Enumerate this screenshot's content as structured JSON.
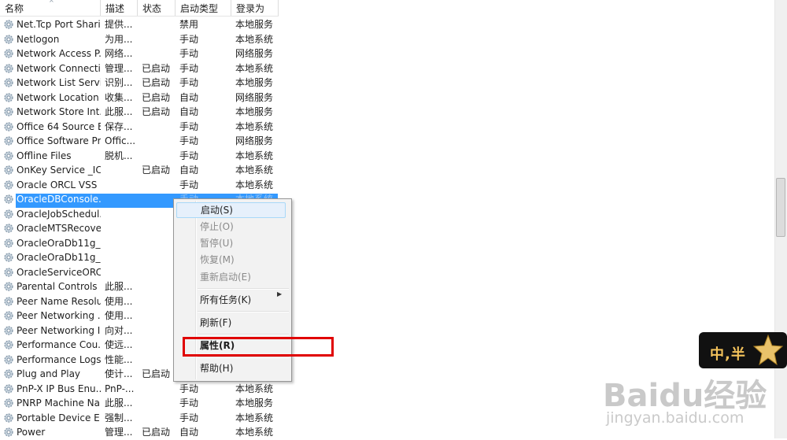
{
  "columns": {
    "name": "名称",
    "desc": "描述",
    "status": "状态",
    "startup": "启动类型",
    "logon": "登录为"
  },
  "rows": [
    {
      "name": "Net.Tcp Port Shari...",
      "desc": "提供...",
      "status": "",
      "startup": "禁用",
      "logon": "本地服务"
    },
    {
      "name": "Netlogon",
      "desc": "为用...",
      "status": "",
      "startup": "手动",
      "logon": "本地系统"
    },
    {
      "name": "Network Access P...",
      "desc": "网络...",
      "status": "",
      "startup": "手动",
      "logon": "网络服务"
    },
    {
      "name": "Network Connecti...",
      "desc": "管理...",
      "status": "已启动",
      "startup": "手动",
      "logon": "本地系统"
    },
    {
      "name": "Network List Service",
      "desc": "识别...",
      "status": "已启动",
      "startup": "手动",
      "logon": "本地服务"
    },
    {
      "name": "Network Location ...",
      "desc": "收集...",
      "status": "已启动",
      "startup": "自动",
      "logon": "网络服务"
    },
    {
      "name": "Network Store Int...",
      "desc": "此服...",
      "status": "已启动",
      "startup": "自动",
      "logon": "本地服务"
    },
    {
      "name": "Office 64 Source E...",
      "desc": "保存...",
      "status": "",
      "startup": "手动",
      "logon": "本地系统"
    },
    {
      "name": "Office Software Pr...",
      "desc": "Offic...",
      "status": "",
      "startup": "手动",
      "logon": "网络服务"
    },
    {
      "name": "Offline Files",
      "desc": "脱机...",
      "status": "",
      "startup": "手动",
      "logon": "本地系统"
    },
    {
      "name": "OnKey Service _IC...",
      "desc": "",
      "status": "已启动",
      "startup": "自动",
      "logon": "本地系统"
    },
    {
      "name": "Oracle ORCL VSS ...",
      "desc": "",
      "status": "",
      "startup": "手动",
      "logon": "本地系统"
    },
    {
      "name": "OracleDBConsole...",
      "desc": "",
      "status": "",
      "startup": "手动",
      "logon": "本地系统"
    },
    {
      "name": "OracleJobSchedul...",
      "desc": "",
      "status": "",
      "startup": "",
      "logon": ""
    },
    {
      "name": "OracleMTSRecove...",
      "desc": "",
      "status": "",
      "startup": "",
      "logon": ""
    },
    {
      "name": "OracleOraDb11g_...",
      "desc": "",
      "status": "",
      "startup": "",
      "logon": ""
    },
    {
      "name": "OracleOraDb11g_...",
      "desc": "",
      "status": "",
      "startup": "",
      "logon": ""
    },
    {
      "name": "OracleServiceORCL",
      "desc": "",
      "status": "",
      "startup": "",
      "logon": ""
    },
    {
      "name": "Parental Controls",
      "desc": "此服...",
      "status": "",
      "startup": "",
      "logon": ""
    },
    {
      "name": "Peer Name Resolu...",
      "desc": "使用...",
      "status": "",
      "startup": "",
      "logon": ""
    },
    {
      "name": "Peer Networking ...",
      "desc": "使用...",
      "status": "",
      "startup": "",
      "logon": ""
    },
    {
      "name": "Peer Networking I...",
      "desc": "向对...",
      "status": "",
      "startup": "",
      "logon": ""
    },
    {
      "name": "Performance Cou...",
      "desc": "使远...",
      "status": "",
      "startup": "",
      "logon": ""
    },
    {
      "name": "Performance Logs...",
      "desc": "性能...",
      "status": "",
      "startup": "",
      "logon": ""
    },
    {
      "name": "Plug and Play",
      "desc": "使计...",
      "status": "已启动",
      "startup": "",
      "logon": ""
    },
    {
      "name": "PnP-X IP Bus Enu...",
      "desc": "PnP-...",
      "status": "",
      "startup": "手动",
      "logon": "本地系统"
    },
    {
      "name": "PNRP Machine Na...",
      "desc": "此服...",
      "status": "",
      "startup": "手动",
      "logon": "本地服务"
    },
    {
      "name": "Portable Device E...",
      "desc": "强制...",
      "status": "",
      "startup": "手动",
      "logon": "本地系统"
    },
    {
      "name": "Power",
      "desc": "管理...",
      "status": "已启动",
      "startup": "自动",
      "logon": "本地系统"
    }
  ],
  "context_menu": {
    "start": "启动(S)",
    "stop": "停止(O)",
    "pause": "暂停(U)",
    "resume": "恢复(M)",
    "restart": "重新启动(E)",
    "all_tasks": "所有任务(K)",
    "refresh": "刷新(F)",
    "properties": "属性(R)",
    "help": "帮助(H)"
  },
  "badge_text": "中,半",
  "watermark": {
    "logo": "Baidu经验",
    "url": "jingyan.baidu.com"
  },
  "colors": {
    "selection": "#3399ff",
    "highlight_box": "#e00000"
  }
}
